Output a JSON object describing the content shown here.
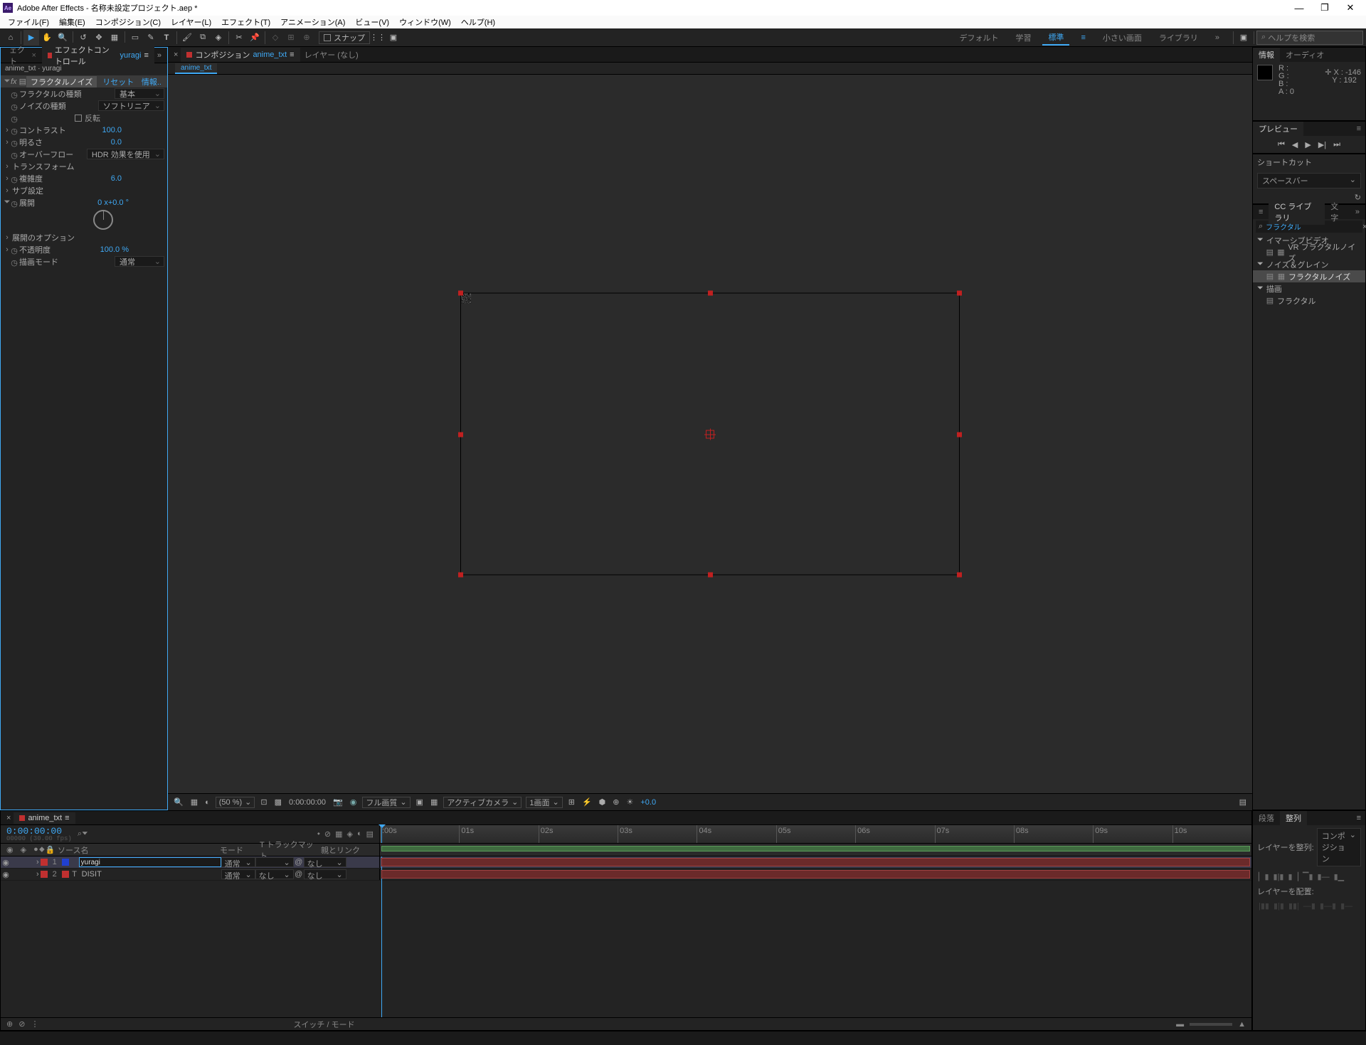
{
  "title": "Adobe After Effects - 名称未設定プロジェクト.aep *",
  "menu": [
    "ファイル(F)",
    "編集(E)",
    "コンポジション(C)",
    "レイヤー(L)",
    "エフェクト(T)",
    "アニメーション(A)",
    "ビュー(V)",
    "ウィンドウ(W)",
    "ヘルプ(H)"
  ],
  "snap_label": "スナップ",
  "workspaces": {
    "items": [
      "デフォルト",
      "学習",
      "標準",
      "小さい画面",
      "ライブラリ"
    ],
    "active": 2
  },
  "search_placeholder": "ヘルプを検索",
  "ect": {
    "tab_prefix": "エフェクトコントロール",
    "layer": "yuragi",
    "path": "anime_txt · yuragi",
    "effect_name": "フラクタルノイズ",
    "reset": "リセット",
    "info": "情報..",
    "rows": {
      "fractal_type_lbl": "フラクタルの種類",
      "fractal_type_val": "基本",
      "noise_type_lbl": "ノイズの種類",
      "noise_type_val": "ソフトリニア",
      "invert_lbl": "反転",
      "contrast_lbl": "コントラスト",
      "contrast_val": "100.0",
      "brightness_lbl": "明るさ",
      "brightness_val": "0.0",
      "overflow_lbl": "オーバーフロー",
      "overflow_val": "HDR 効果を使用",
      "transform_lbl": "トランスフォーム",
      "complexity_lbl": "複雑度",
      "complexity_val": "6.0",
      "sub_lbl": "サブ設定",
      "evolution_lbl": "展開",
      "evolution_val": "0 x+0.0 °",
      "evo_opt_lbl": "展開のオプション",
      "opacity_lbl": "不透明度",
      "opacity_val": "100.0 %",
      "blend_lbl": "描画モード",
      "blend_val": "通常"
    }
  },
  "comp": {
    "tab_label": "コンポジション",
    "name": "anime_txt",
    "layer_label": "レイヤー",
    "layer_none": "(なし)"
  },
  "viewer_footer": {
    "zoom": "(50 %)",
    "tc": "0:00:00:00",
    "res": "フル画質",
    "camera": "アクティブカメラ",
    "views": "1画面",
    "exposure": "+0.0"
  },
  "info": {
    "tab1": "情報",
    "tab2": "オーディオ",
    "r": "R :",
    "g": "G :",
    "b": "B :",
    "a": "A :   0",
    "x": "X : -146",
    "y": "Y : 192"
  },
  "preview": {
    "tab": "プレビュー"
  },
  "shortcut": {
    "label": "ショートカット",
    "value": "スペースバー"
  },
  "effbrowse": {
    "tabs": [
      "CC ライブラリ",
      "文字"
    ],
    "search": "フラクタル",
    "groups": {
      "immersive": "イマーシブビデオ",
      "vr": "VR フラクタルノイズ",
      "noise": "ノイズ＆グレイン",
      "fractal_noise": "フラクタルノイズ",
      "draw": "描画",
      "fractal": "フラクタル"
    }
  },
  "timeline": {
    "comp": "anime_txt",
    "tc": "0:00:00:00",
    "tc_sub": "00000 (30.00 fps)",
    "cols": {
      "source": "ソース名",
      "mode": "モード",
      "trkmat": "T トラックマット",
      "parent": "親とリンク"
    },
    "ticks": [
      ":00s",
      "01s",
      "02s",
      "03s",
      "04s",
      "05s",
      "06s",
      "07s",
      "08s",
      "09s",
      "10s"
    ],
    "layers": [
      {
        "idx": 1,
        "color": "#2040d0",
        "label_bg": "#c03030",
        "name": "yuragi",
        "editing": true,
        "mode": "通常",
        "trk": "",
        "parent": "なし",
        "type": "solid"
      },
      {
        "idx": 2,
        "color": "#c03030",
        "label_bg": "#c03030",
        "name": "DISIT",
        "editing": false,
        "mode": "通常",
        "trk": "なし",
        "parent": "なし",
        "type": "text"
      }
    ],
    "toggle_label": "スイッチ / モード"
  },
  "align": {
    "tab1": "段落",
    "tab2": "整列",
    "align_to_lbl": "レイヤーを整列:",
    "align_to": "コンポジション",
    "distribute_lbl": "レイヤーを配置:"
  }
}
